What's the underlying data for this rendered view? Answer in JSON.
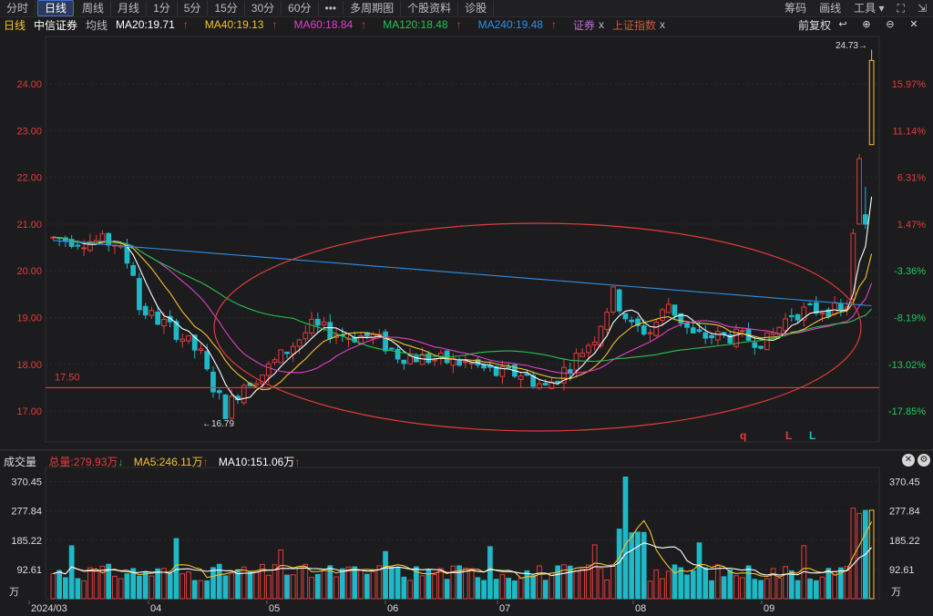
{
  "toolbar": {
    "periods": [
      "分时",
      "日线",
      "周线",
      "月线",
      "1分",
      "5分",
      "15分",
      "30分",
      "60分",
      "•••",
      "多周期图",
      "个股资料",
      "诊股"
    ],
    "active_index": 1,
    "right": [
      "筹码",
      "画线",
      "工具"
    ]
  },
  "info": {
    "period": "日线",
    "stock": "中信证券",
    "avg": "均线",
    "ma20": "MA20:19.71",
    "ma40": "MA40:19.13",
    "ma60": "MA60:18.84",
    "ma120": "MA120:18.48",
    "ma240": "MA240:19.48",
    "overlay1": "证券",
    "overlay2": "上证指数",
    "close_mark": "x",
    "adjust": "前复权"
  },
  "price_axis": {
    "labels": [
      "24.00",
      "23.00",
      "22.00",
      "21.00",
      "20.00",
      "19.00",
      "18.00",
      "17.00"
    ],
    "pct_labels": [
      "15.97%",
      "11.14%",
      "6.31%",
      "1.47%",
      "-3.36%",
      "-8.19%",
      "-13.02%",
      "-17.85%"
    ]
  },
  "annotations": {
    "high": "24.73",
    "low": "16.79",
    "hline": "17.50",
    "signals": [
      "q",
      "L",
      "L"
    ]
  },
  "volume": {
    "title": "成交量",
    "total": "总量:279.93万",
    "ma5": "MA5:246.11万",
    "ma10": "MA10:151.06万",
    "axis_labels": [
      "370.45",
      "277.84",
      "185.22",
      "92.61"
    ],
    "unit": "万"
  },
  "time_axis": [
    "2024/03",
    "04",
    "05",
    "06",
    "07",
    "08",
    "09"
  ],
  "colors": {
    "up": "#e03c3c",
    "down": "#1fb8c7",
    "ma20": "#ffffff",
    "ma40": "#f2c230",
    "ma60": "#e040c8",
    "ma120": "#28c050",
    "ma240": "#2f8fe6"
  }
}
